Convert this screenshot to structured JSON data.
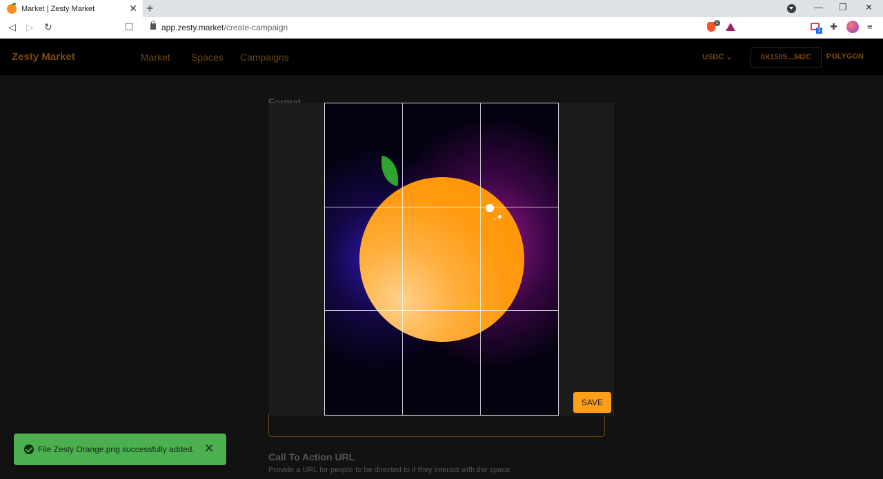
{
  "browser": {
    "tab_title": "Market | Zesty Market",
    "tab_close": "✕",
    "new_tab": "+",
    "url_host": "app.zesty.market",
    "url_path": "/create-campaign",
    "brave_badge": "1",
    "wallet_badge": "1",
    "nav_back": "◁",
    "nav_forward": "▷",
    "nav_reload": "↻",
    "bookmark": "☐",
    "puzzle": "✚",
    "menu": "≡",
    "minimize": "—",
    "restore": "❐",
    "close": "✕"
  },
  "app": {
    "brand": "Zesty Market",
    "nav": [
      "Market",
      "Spaces",
      "Campaigns"
    ],
    "currency": "USDC ⌄",
    "wallet_address": "0X1509...342C",
    "network": "POLYGON"
  },
  "page": {
    "format_heading": "Format",
    "cta_title": "Call To Action URL",
    "cta_description": "Provide a URL for people to be directed to if they interact with the space."
  },
  "crop_dialog": {
    "save_label": "SAVE"
  },
  "toast": {
    "message": "File Zesty Orange.png successfully added.",
    "close": "✕",
    "color": "#4caf50"
  },
  "colors": {
    "accent": "#ff9f1a",
    "nav_text": "#6b4714"
  }
}
